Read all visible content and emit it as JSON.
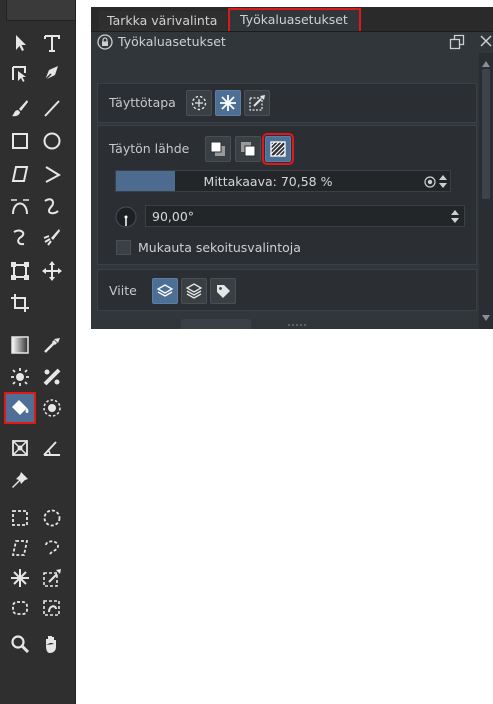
{
  "tabs": {
    "color_selector": "Tarkka värivalinta",
    "tool_options": "Työkaluasetukset"
  },
  "panel": {
    "title": "Työkaluasetukset",
    "fill_mode_label": "Täyttötapa",
    "fill_source_label": "Täytön lähde",
    "scale_label": "Mittakaava: 70,58 %",
    "scale_value": 70.58,
    "angle_value": "90,00°",
    "blend_checkbox_label": "Mukauta sekoitusvalintoja",
    "blend_checked": false,
    "reference_label": "Viite",
    "selected_fill_mode": "similar-color",
    "selected_fill_source": "pattern",
    "selected_reference": "current-layer"
  },
  "colors": {
    "toolbar_bg": "#2f2f2f",
    "panel_bg": "#31363b",
    "accent": "#4e6f94",
    "highlight_outline": "#e01818"
  },
  "toolbox": {
    "selected_tool": "fill-tool",
    "tools": [
      "select-shapes-tool",
      "text-tool",
      "edit-shapes-tool",
      "calligraphy-tool",
      "freehand-brush-tool",
      "line-tool",
      "rectangle-tool",
      "ellipse-tool",
      "polygon-tool",
      "polyline-tool",
      "bezier-curve-tool",
      "freehand-path-tool",
      "dynamic-brush-tool",
      "multibrush-tool",
      "transform-tool",
      "move-tool",
      "crop-tool",
      "gradient-tool",
      "color-sampler-tool",
      "smart-patch-tool",
      "colorize-mask-tool",
      "fill-tool",
      "enclose-and-fill-tool",
      "assistant-tool",
      "measure-tool",
      "reference-images-tool",
      "rectangular-selection-tool",
      "elliptical-selection-tool",
      "polygonal-selection-tool",
      "freehand-selection-tool",
      "contiguous-selection-tool",
      "similar-color-selection-tool",
      "bezier-selection-tool",
      "magnetic-selection-tool",
      "zoom-tool",
      "pan-tool"
    ]
  }
}
